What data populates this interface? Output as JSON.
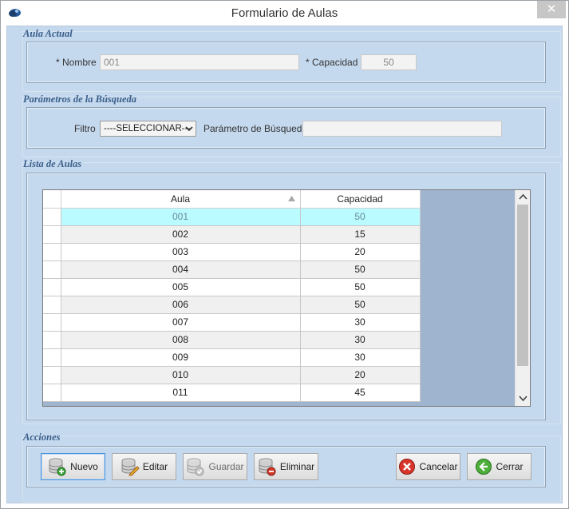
{
  "window": {
    "title": "Formulario de Aulas",
    "close_glyph": "✕"
  },
  "aula_actual": {
    "title": "Aula Actual",
    "nombre_label": "* Nombre",
    "nombre_value": "001",
    "capacidad_label": "* Capacidad",
    "capacidad_value": "50"
  },
  "busqueda": {
    "title": "Parámetros de la Búsqueda",
    "filtro_label": "Filtro",
    "filtro_selected": "----SELECCIONAR---",
    "parametro_label": "Parámetro de Búsqueda",
    "parametro_value": ""
  },
  "lista": {
    "title": "Lista de Aulas",
    "columns": [
      "Aula",
      "Capacidad"
    ],
    "rows": [
      {
        "aula": "001",
        "capacidad": "50"
      },
      {
        "aula": "002",
        "capacidad": "15"
      },
      {
        "aula": "003",
        "capacidad": "20"
      },
      {
        "aula": "004",
        "capacidad": "50"
      },
      {
        "aula": "005",
        "capacidad": "50"
      },
      {
        "aula": "006",
        "capacidad": "50"
      },
      {
        "aula": "007",
        "capacidad": "30"
      },
      {
        "aula": "008",
        "capacidad": "30"
      },
      {
        "aula": "009",
        "capacidad": "30"
      },
      {
        "aula": "010",
        "capacidad": "20"
      },
      {
        "aula": "011",
        "capacidad": "45"
      }
    ],
    "selected_index": 0
  },
  "acciones": {
    "title": "Acciones",
    "nuevo": "Nuevo",
    "editar": "Editar",
    "guardar": "Guardar",
    "eliminar": "Eliminar",
    "cancelar": "Cancelar",
    "cerrar": "Cerrar"
  },
  "icons": {
    "app": "app-icon",
    "nuevo": "database-add-icon",
    "editar": "database-edit-icon",
    "guardar": "database-save-icon",
    "eliminar": "database-delete-icon",
    "cancelar": "cancel-icon",
    "cerrar": "back-arrow-icon"
  },
  "colors": {
    "panel_bg": "#c5d9ee",
    "section_title": "#3a5f8a",
    "selected_row": "#b9fbff",
    "grid_empty": "#9fb4cf"
  }
}
